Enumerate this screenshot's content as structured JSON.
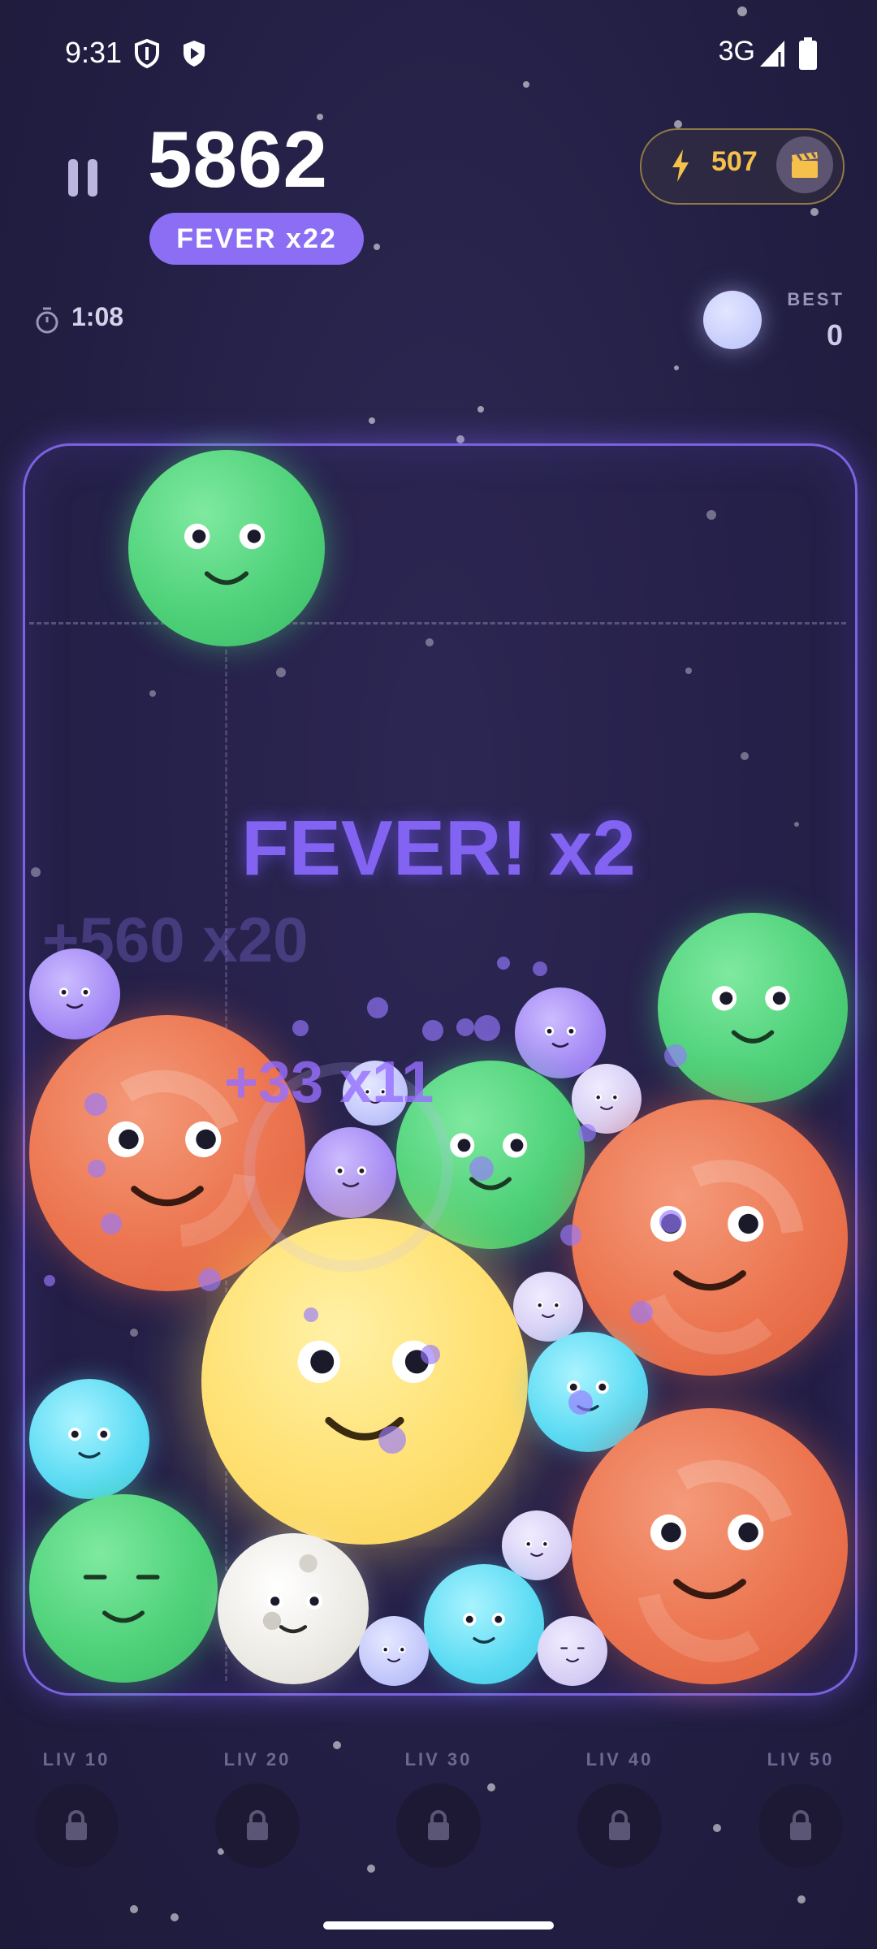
{
  "status_bar": {
    "time": "9:31",
    "network": "3G"
  },
  "header": {
    "score": "5862",
    "fever_badge": "FEVER  x22",
    "energy": "507",
    "timer": "1:08",
    "best_label": "BEST",
    "best_value": "0"
  },
  "field": {
    "fever_banner": "FEVER! x2",
    "float_score_faded": "+560  x20",
    "float_score": "+33  x11"
  },
  "levels": [
    {
      "label": "LIV 10"
    },
    {
      "label": "LIV 20"
    },
    {
      "label": "LIV 30"
    },
    {
      "label": "LIV 40"
    },
    {
      "label": "LIV 50"
    }
  ],
  "colors": {
    "accent": "#8c6ef5",
    "energy": "#f5c14b",
    "field_border": "#7b62e0"
  },
  "icons": [
    "shield-icon",
    "play-shield-icon",
    "signal-icon",
    "battery-icon",
    "pause-icon",
    "bolt-icon",
    "clapperboard-icon",
    "timer-icon",
    "lock-icon"
  ]
}
